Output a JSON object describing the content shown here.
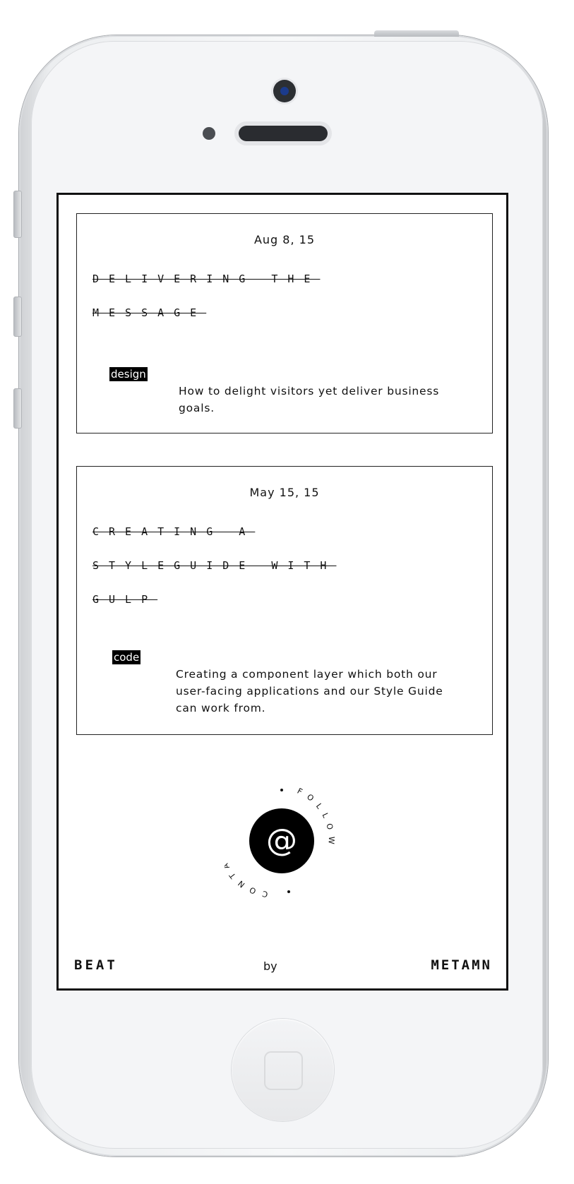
{
  "posts": [
    {
      "date": "Aug 8, 15",
      "title_lines": [
        "Delivering the",
        "message"
      ],
      "tag": "design",
      "description": "How to delight visitors yet deliver business goals."
    },
    {
      "date": "May 15, 15",
      "title_lines": [
        "Creating a",
        "Styleguide with",
        "Gulp"
      ],
      "tag": "code",
      "description": "Creating a component layer which both our user-facing applications and our Style Guide can work from."
    }
  ],
  "badge": {
    "ring_left": "CONTACT",
    "ring_right": "FOLLOW",
    "icon": "at-sign-icon",
    "symbol": "@"
  },
  "footer": {
    "brand_left": "BEAT",
    "by": "by",
    "brand_right": "METAMN"
  },
  "colors": {
    "ink": "#111111",
    "screen_bg": "#ffffff",
    "device_bg": "#f4f5f7"
  }
}
